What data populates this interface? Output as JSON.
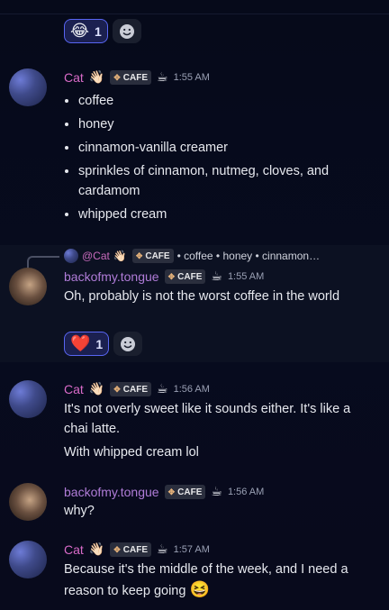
{
  "top_reactions": [
    {
      "emoji": "😂",
      "count": "1",
      "active": true
    },
    {
      "emoji": "add-reaction"
    }
  ],
  "messages": [
    {
      "author": "Cat",
      "badge_emoji": "👋🏻",
      "tag": "CAFE",
      "tag_icon": "✥",
      "cup": "☕",
      "time": "1:55 AM",
      "list": [
        "coffee",
        "honey",
        "cinnamon-vanilla creamer",
        "sprinkles of cinnamon, nutmeg, cloves, and cardamom",
        "whipped cream"
      ]
    },
    {
      "author": "backofmy.tongue",
      "tag": "CAFE",
      "tag_icon": "✥",
      "cup": "☕",
      "time": "1:55 AM",
      "text": "Oh, probably is not the worst coffee in the world",
      "reply": {
        "name": "@Cat",
        "hand": "👋🏻",
        "tag": "CAFE",
        "preview": "• coffee  • honey  • cinnamon…"
      },
      "reaction": {
        "emoji": "❤️",
        "count": "1"
      }
    },
    {
      "author": "Cat",
      "badge_emoji": "👋🏻",
      "tag": "CAFE",
      "tag_icon": "✥",
      "cup": "☕",
      "time": "1:56 AM",
      "lines": [
        "It's not overly sweet like it sounds either. It's like a chai latte.",
        "With whipped cream lol"
      ]
    },
    {
      "author": "backofmy.tongue",
      "tag": "CAFE",
      "tag_icon": "✥",
      "cup": "☕",
      "time": "1:56 AM",
      "text": "why?"
    },
    {
      "author": "Cat",
      "badge_emoji": "👋🏻",
      "tag": "CAFE",
      "tag_icon": "✥",
      "cup": "☕",
      "time": "1:57 AM",
      "text": "Because it's the middle of the week, and I need a reason to keep going",
      "trailing_emoji": "😆"
    }
  ]
}
